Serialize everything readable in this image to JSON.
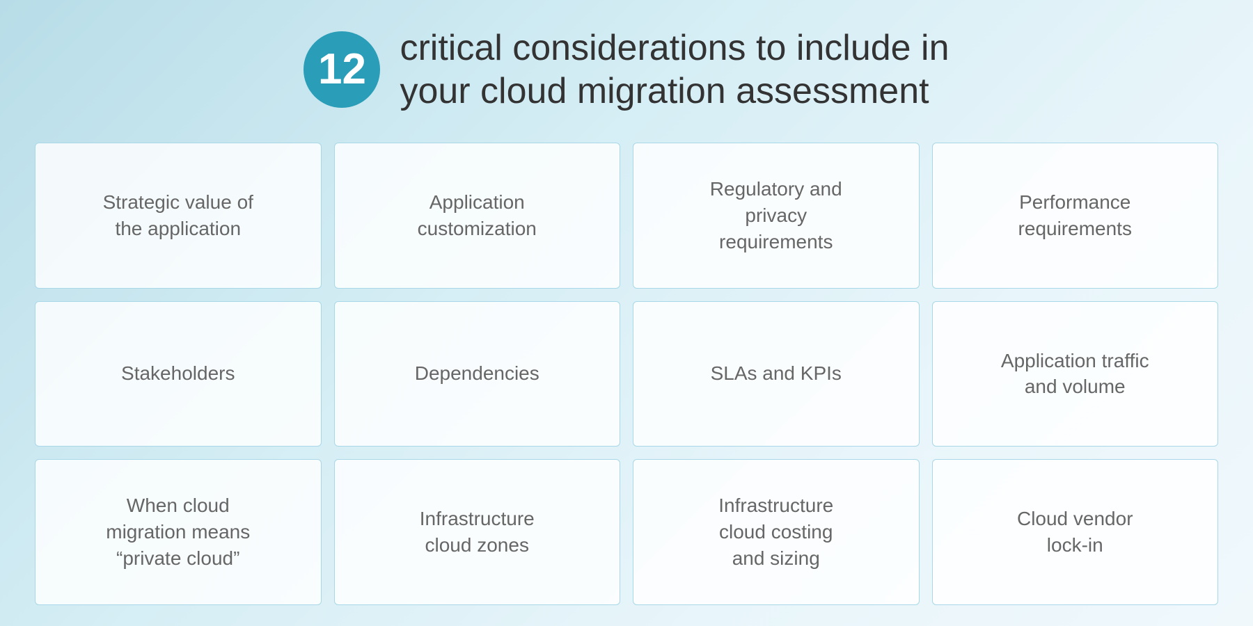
{
  "header": {
    "number": "12",
    "title_line1": "critical considerations to include in",
    "title_line2": "your cloud migration assessment"
  },
  "cards": [
    {
      "id": "card-1",
      "label": "Strategic value of\nthe application"
    },
    {
      "id": "card-2",
      "label": "Application\ncustomization"
    },
    {
      "id": "card-3",
      "label": "Regulatory and\nprivacy\nrequirements"
    },
    {
      "id": "card-4",
      "label": "Performance\nrequirements"
    },
    {
      "id": "card-5",
      "label": "Stakeholders"
    },
    {
      "id": "card-6",
      "label": "Dependencies"
    },
    {
      "id": "card-7",
      "label": "SLAs and KPIs"
    },
    {
      "id": "card-8",
      "label": "Application traffic\nand volume"
    },
    {
      "id": "card-9",
      "label": "When cloud\nmigration means\n“private cloud”"
    },
    {
      "id": "card-10",
      "label": "Infrastructure\ncloud zones"
    },
    {
      "id": "card-11",
      "label": "Infrastructure\ncloud costing\nand sizing"
    },
    {
      "id": "card-12",
      "label": "Cloud vendor\nlock-in"
    }
  ]
}
